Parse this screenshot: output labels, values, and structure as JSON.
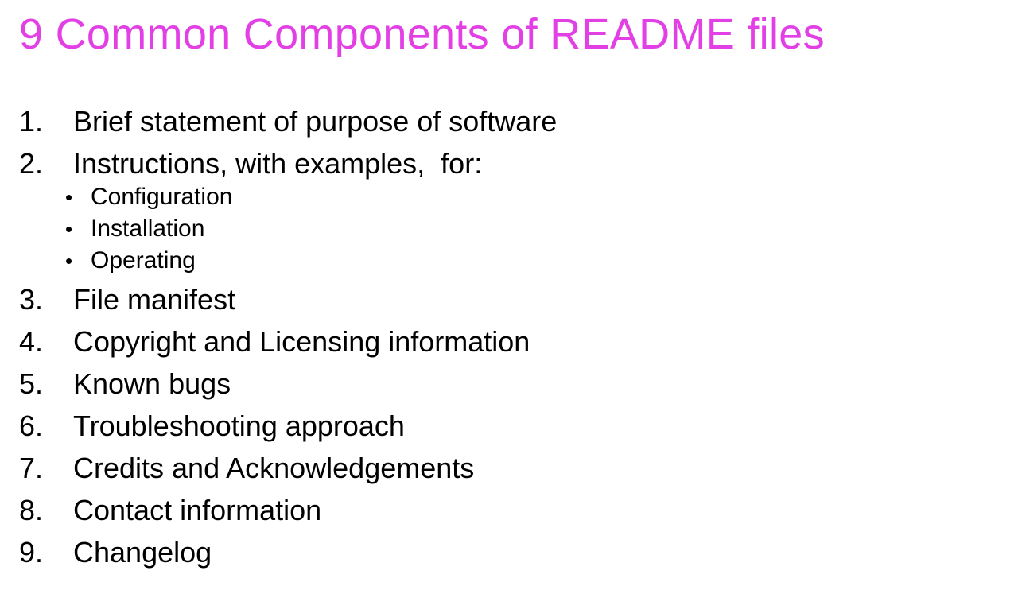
{
  "slide": {
    "title": "9 Common Components of README files",
    "title_color": "#e23fe5",
    "items": [
      {
        "number": "1.",
        "text": "Brief statement of purpose of software"
      },
      {
        "number": "2.",
        "text": "Instructions, with examples,  for:",
        "subitems": [
          {
            "bullet": "•",
            "text": "Configuration"
          },
          {
            "bullet": "•",
            "text": "Installation"
          },
          {
            "bullet": "•",
            "text": "Operating"
          }
        ]
      },
      {
        "number": "3.",
        "text": "File manifest"
      },
      {
        "number": "4.",
        "text": "Copyright and Licensing information"
      },
      {
        "number": "5.",
        "text": "Known bugs"
      },
      {
        "number": "6.",
        "text": "Troubleshooting approach"
      },
      {
        "number": "7.",
        "text": "Credits and Acknowledgements"
      },
      {
        "number": "8.",
        "text": "Contact information"
      },
      {
        "number": "9.",
        "text": "Changelog"
      }
    ]
  }
}
